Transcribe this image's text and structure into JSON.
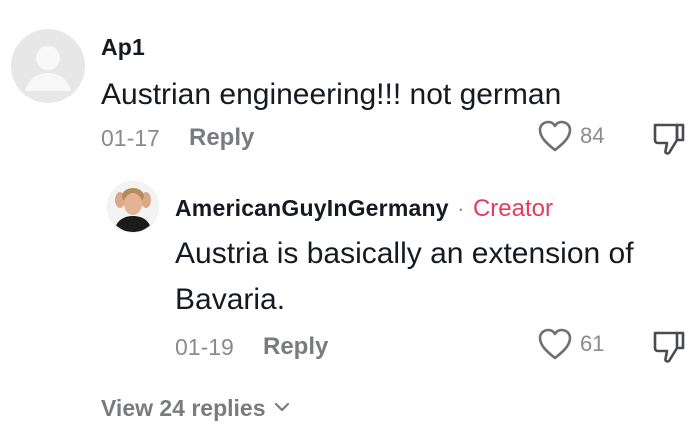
{
  "comment": {
    "username": "Ap1",
    "text": "Austrian engineering!!! not german",
    "date": "01-17",
    "reply_label": "Reply",
    "likes": "84"
  },
  "reply": {
    "username": "AmericanGuyInGermany",
    "separator": "·",
    "badge": "Creator",
    "text_line1": "Austria is basically an extension of",
    "text_line2": "Bavaria.",
    "date": "01-19",
    "reply_label": "Reply",
    "likes": "61"
  },
  "thread": {
    "view_replies_label": "View 24 replies"
  },
  "colors": {
    "text": "#161823",
    "muted": "#8a8b91",
    "creator_accent": "#e63c59"
  },
  "icons": {
    "like": "heart-outline-icon",
    "dislike": "thumbs-down-outline-icon",
    "expand": "chevron-down-icon"
  }
}
